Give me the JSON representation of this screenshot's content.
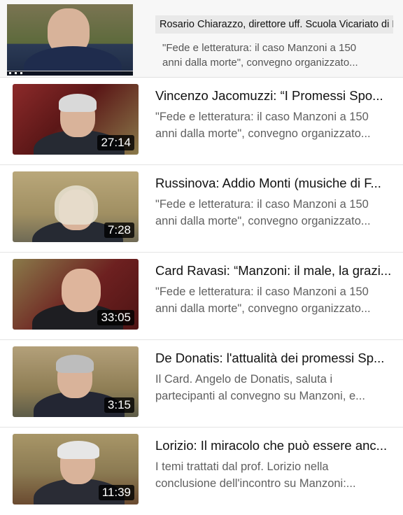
{
  "top_item": {
    "title": "Rosario Chiarazzo, direttore uff. Scuola Vicariato di Roma",
    "desc_line1": "\"Fede e letteratura: il caso Manzoni a 150",
    "desc_line2": "anni dalla morte\", convegno organizzato..."
  },
  "videos": [
    {
      "title": "Vincenzo Jacomuzzi: “I Promessi Spo...",
      "desc_line1": "\"Fede e letteratura: il caso Manzoni a 150",
      "desc_line2": "anni dalla morte\", convegno organizzato...",
      "duration": "27:14"
    },
    {
      "title": "Russinova: Addio Monti (musiche di F...",
      "desc_line1": "\"Fede e letteratura: il caso Manzoni a 150",
      "desc_line2": "anni dalla morte\", convegno organizzato...",
      "duration": "7:28"
    },
    {
      "title": "Card Ravasi: “Manzoni: il male, la grazi...",
      "desc_line1": "\"Fede e letteratura: il caso Manzoni a 150",
      "desc_line2": "anni dalla morte\", convegno organizzato...",
      "duration": "33:05"
    },
    {
      "title": "De Donatis: l'attualità dei promessi Sp...",
      "desc_line1": "Il Card. Angelo de Donatis, saluta i",
      "desc_line2": "partecipanti al convegno su Manzoni, e...",
      "duration": "3:15"
    },
    {
      "title": "Lorizio: Il miracolo che può essere anc...",
      "desc_line1": "I temi trattati dal prof. Lorizio nella",
      "desc_line2": "conclusione dell'incontro su Manzoni:...",
      "duration": "11:39"
    }
  ]
}
